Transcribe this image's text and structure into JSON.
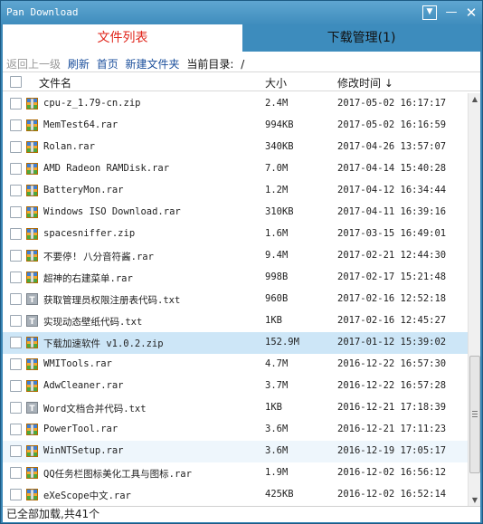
{
  "window": {
    "title": "Pan Download",
    "menu_glyph": "▼",
    "minimize_glyph": "—",
    "close_glyph": "✕"
  },
  "tabs": [
    {
      "label": "文件列表",
      "active": true
    },
    {
      "label": "下载管理(1)",
      "active": false
    }
  ],
  "toolbar": {
    "back_label": "返回上一级",
    "refresh_label": "刷新",
    "home_label": "首页",
    "new_folder_label": "新建文件夹",
    "current_dir_label": "当前目录:",
    "current_dir_value": "/"
  },
  "table": {
    "columns": {
      "name": "文件名",
      "size": "大小",
      "modified": "修改时间 ↓"
    },
    "rows": [
      {
        "name": "cpu-z_1.79-cn.zip",
        "size": "2.4M",
        "modified": "2017-05-02 16:17:17",
        "icon": "archive-icon"
      },
      {
        "name": "MemTest64.rar",
        "size": "994KB",
        "modified": "2017-05-02 16:16:59",
        "icon": "archive-icon"
      },
      {
        "name": "Rolan.rar",
        "size": "340KB",
        "modified": "2017-04-26 13:57:07",
        "icon": "archive-icon"
      },
      {
        "name": "AMD Radeon RAMDisk.rar",
        "size": "7.0M",
        "modified": "2017-04-14 15:40:28",
        "icon": "archive-icon"
      },
      {
        "name": "BatteryMon.rar",
        "size": "1.2M",
        "modified": "2017-04-12 16:34:44",
        "icon": "archive-icon"
      },
      {
        "name": "Windows ISO Download.rar",
        "size": "310KB",
        "modified": "2017-04-11 16:39:16",
        "icon": "archive-icon"
      },
      {
        "name": "spacesniffer.zip",
        "size": "1.6M",
        "modified": "2017-03-15 16:49:01",
        "icon": "archive-icon"
      },
      {
        "name": "不要停! 八分音符酱.rar",
        "size": "9.4M",
        "modified": "2017-02-21 12:44:30",
        "icon": "archive-icon"
      },
      {
        "name": "超神的右建菜单.rar",
        "size": "998B",
        "modified": "2017-02-17 15:21:48",
        "icon": "archive-icon"
      },
      {
        "name": "获取管理员权限注册表代码.txt",
        "size": "960B",
        "modified": "2017-02-16 12:52:18",
        "icon": "text-file-icon"
      },
      {
        "name": "实现动态壁纸代码.txt",
        "size": "1KB",
        "modified": "2017-02-16 12:45:27",
        "icon": "text-file-icon"
      },
      {
        "name": "下载加速软件 v1.0.2.zip",
        "size": "152.9M",
        "modified": "2017-01-12 15:39:02",
        "icon": "archive-icon"
      },
      {
        "name": "WMITools.rar",
        "size": "4.7M",
        "modified": "2016-12-22 16:57:30",
        "icon": "archive-icon"
      },
      {
        "name": "AdwCleaner.rar",
        "size": "3.7M",
        "modified": "2016-12-22 16:57:28",
        "icon": "archive-icon"
      },
      {
        "name": "Word文档合并代码.txt",
        "size": "1KB",
        "modified": "2016-12-21 17:18:39",
        "icon": "text-file-icon"
      },
      {
        "name": "PowerTool.rar",
        "size": "3.6M",
        "modified": "2016-12-21 17:11:23",
        "icon": "archive-icon"
      },
      {
        "name": "WinNTSetup.rar",
        "size": "3.6M",
        "modified": "2016-12-19 17:05:17",
        "icon": "archive-icon"
      },
      {
        "name": "QQ任务栏图标美化工具与图标.rar",
        "size": "1.9M",
        "modified": "2016-12-02 16:56:12",
        "icon": "archive-icon"
      },
      {
        "name": "eXeScope中文.rar",
        "size": "425KB",
        "modified": "2016-12-02 16:52:14",
        "icon": "archive-icon"
      }
    ]
  },
  "status": {
    "text": "已全部加载,共41个"
  },
  "colors": {
    "title_bar": "#3f8dbd",
    "active_tab_text": "#e0251b",
    "link": "#1b4f9c",
    "selected_row": "#cde6f7"
  }
}
